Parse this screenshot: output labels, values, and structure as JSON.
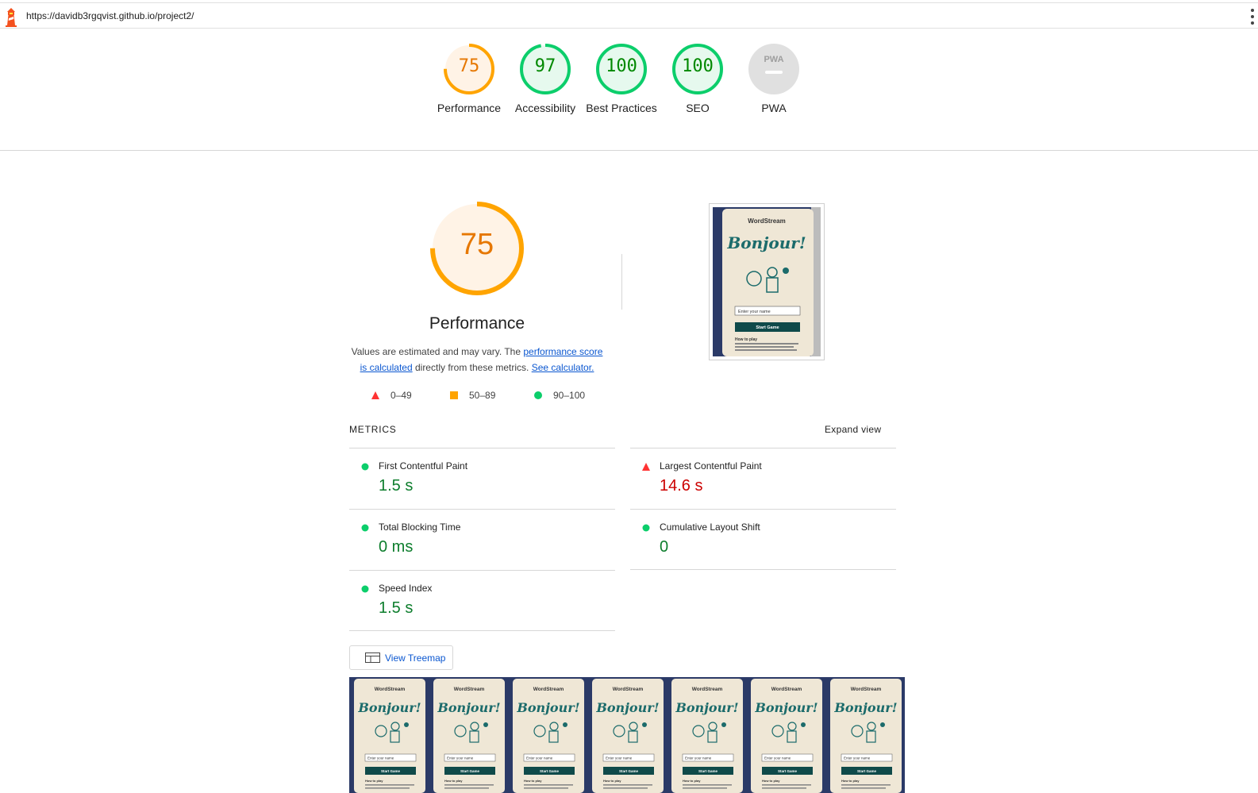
{
  "topbar": {
    "url": "https://davidb3rgqvist.github.io/project2/",
    "logo_icon": "lighthouse-icon",
    "menu_icon": "kebab-menu-icon"
  },
  "categories": [
    {
      "label": "Performance",
      "score": "75",
      "score_value": 75,
      "color": "#e67700",
      "ring": "#ffa400",
      "fill": "#fff3e6"
    },
    {
      "label": "Accessibility",
      "score": "97",
      "score_value": 97,
      "color": "#008800",
      "ring": "#0cce6b",
      "fill": "#e6f9ee"
    },
    {
      "label": "Best Practices",
      "score": "100",
      "score_value": 100,
      "color": "#008800",
      "ring": "#0cce6b",
      "fill": "#e6f9ee"
    },
    {
      "label": "SEO",
      "score": "100",
      "score_value": 100,
      "color": "#008800",
      "ring": "#0cce6b",
      "fill": "#e6f9ee"
    },
    {
      "label": "PWA",
      "badge": "PWA",
      "color": "#9e9e9e",
      "fill": "#e0e0e0"
    }
  ],
  "performance": {
    "score": "75",
    "score_value": 75,
    "title": "Performance",
    "desc_prefix": "Values are estimated and may vary. The ",
    "desc_link1": "performance score is calculated",
    "desc_middle": " directly from these metrics. ",
    "desc_link2": "See calculator.",
    "legend": [
      {
        "range": "0–49",
        "shape": "triangle",
        "color": "#ff3333"
      },
      {
        "range": "50–89",
        "shape": "square",
        "color": "#ffa400"
      },
      {
        "range": "90–100",
        "shape": "circle",
        "color": "#0cce6b"
      }
    ]
  },
  "page_preview": {
    "brand": "WordStream",
    "headline": "Bonjour!",
    "input_placeholder": "Enter your name",
    "button": "Start Game",
    "how_to": "How to play"
  },
  "metrics": {
    "heading": "METRICS",
    "expand": "Expand view",
    "items": [
      {
        "name": "First Contentful Paint",
        "value": "1.5 s",
        "status": "pass"
      },
      {
        "name": "Largest Contentful Paint",
        "value": "14.6 s",
        "status": "fail"
      },
      {
        "name": "Total Blocking Time",
        "value": "0 ms",
        "status": "pass"
      },
      {
        "name": "Cumulative Layout Shift",
        "value": "0",
        "status": "pass"
      },
      {
        "name": "Speed Index",
        "value": "1.5 s",
        "status": "pass"
      }
    ]
  },
  "treemap": {
    "label": "View Treemap",
    "icon": "treemap-icon"
  },
  "filmstrip": {
    "frames": 7
  }
}
